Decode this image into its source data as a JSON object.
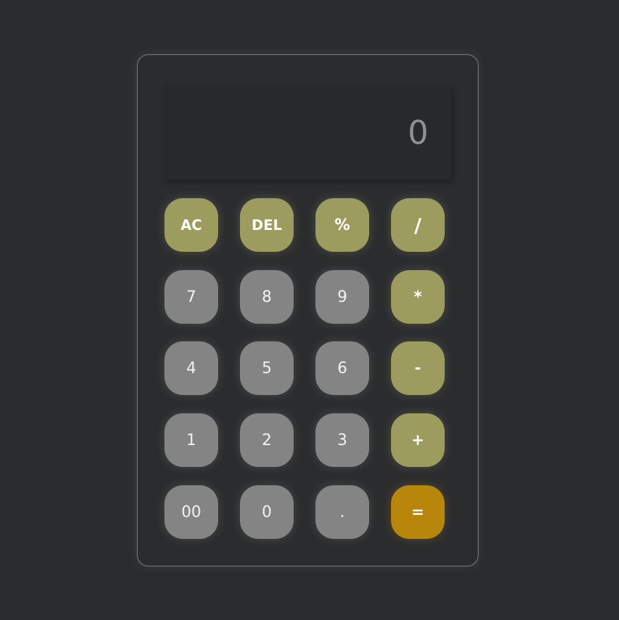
{
  "display": {
    "value": "0"
  },
  "keys": {
    "ac": "AC",
    "del": "DEL",
    "percent": "%",
    "divide": "/",
    "seven": "7",
    "eight": "8",
    "nine": "9",
    "multiply": "*",
    "four": "4",
    "five": "5",
    "six": "6",
    "minus": "-",
    "one": "1",
    "two": "2",
    "three": "3",
    "plus": "+",
    "double_zero": "00",
    "zero": "0",
    "decimal": ".",
    "equals": "="
  },
  "colors": {
    "background": "#2b2c2e",
    "number_key": "#848484",
    "operator_key": "#9b9c5e",
    "equals_key": "#b8860b",
    "display_text": "#8f9092"
  }
}
